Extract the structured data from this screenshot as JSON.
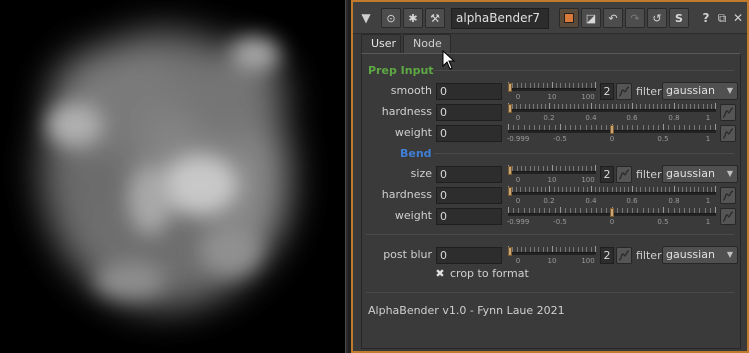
{
  "node": {
    "name": "alphaBender7"
  },
  "tabs": [
    {
      "label": "User"
    },
    {
      "label": "Node"
    }
  ],
  "sections": {
    "prep": {
      "title": "Prep Input",
      "color": "#5ea844"
    },
    "bend": {
      "title": "Bend",
      "color": "#3f7fd6"
    }
  },
  "params": {
    "prep_smooth": {
      "label": "smooth",
      "value": "0",
      "filter_size": "2",
      "filter_label": "filter",
      "filter": "gaussian"
    },
    "prep_hardness": {
      "label": "hardness",
      "value": "0"
    },
    "prep_weight": {
      "label": "weight",
      "value": "0"
    },
    "bend_size": {
      "label": "size",
      "value": "0",
      "filter_size": "2",
      "filter_label": "filter",
      "filter": "gaussian"
    },
    "bend_hardness": {
      "label": "hardness",
      "value": "0"
    },
    "bend_weight": {
      "label": "weight",
      "value": "0"
    },
    "post_blur": {
      "label": "post blur",
      "value": "0",
      "filter_size": "2",
      "filter_label": "filter",
      "filter": "gaussian"
    }
  },
  "slider_ticks": {
    "range_100": [
      "0",
      "10",
      "100"
    ],
    "range_1": [
      "0",
      "0.2",
      "0.4",
      "0.6",
      "0.8",
      "1"
    ],
    "range_weight": [
      "-0.999",
      "-0.5",
      "0",
      "0.5",
      "1"
    ]
  },
  "crop_to_format": {
    "label": "crop to format",
    "checked": true
  },
  "footer": {
    "text": "AlphaBender v1.0 - Fynn Laue 2021"
  },
  "accent": "#c27a2c"
}
